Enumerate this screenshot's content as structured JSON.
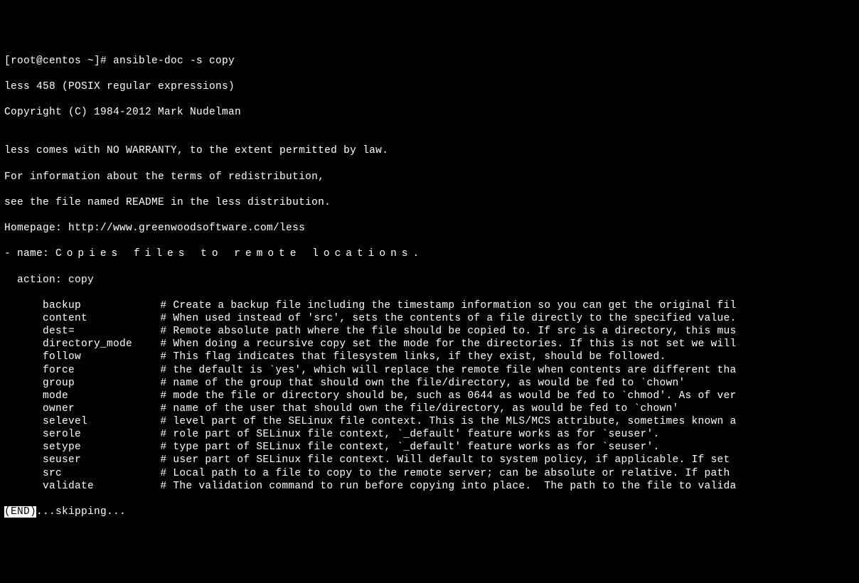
{
  "prompt": "[root@centos ~]# ansible-doc -s copy",
  "less_version": "less 458 (POSIX regular expressions)",
  "copyright": "Copyright (C) 1984-2012 Mark Nudelman",
  "blank": "",
  "warranty": "less comes with NO WARRANTY, to the extent permitted by law.",
  "info1": "For information about the terms of redistribution,",
  "info2": "see the file named README in the less distribution.",
  "homepage": "Homepage: http://www.greenwoodsoftware.com/less",
  "name_prefix": "- name:",
  "name_text": "Copies files to remote locations.",
  "action": "  action: copy",
  "indent": "      ",
  "sep": "# ",
  "options": [
    {
      "name": "backup",
      "desc": "Create a backup file including the timestamp information so you can get the original fil"
    },
    {
      "name": "content",
      "desc": "When used instead of 'src', sets the contents of a file directly to the specified value."
    },
    {
      "name": "dest=",
      "desc": "Remote absolute path where the file should be copied to. If src is a directory, this mus"
    },
    {
      "name": "directory_mode",
      "desc": "When doing a recursive copy set the mode for the directories. If this is not set we will"
    },
    {
      "name": "follow",
      "desc": "This flag indicates that filesystem links, if they exist, should be followed."
    },
    {
      "name": "force",
      "desc": "the default is `yes', which will replace the remote file when contents are different tha"
    },
    {
      "name": "group",
      "desc": "name of the group that should own the file/directory, as would be fed to `chown'"
    },
    {
      "name": "mode",
      "desc": "mode the file or directory should be, such as 0644 as would be fed to `chmod'. As of ver"
    },
    {
      "name": "owner",
      "desc": "name of the user that should own the file/directory, as would be fed to `chown'"
    },
    {
      "name": "selevel",
      "desc": "level part of the SELinux file context. This is the MLS/MCS attribute, sometimes known a"
    },
    {
      "name": "serole",
      "desc": "role part of SELinux file context, `_default' feature works as for `seuser'."
    },
    {
      "name": "setype",
      "desc": "type part of SELinux file context, `_default' feature works as for `seuser'."
    },
    {
      "name": "seuser",
      "desc": "user part of SELinux file context. Will default to system policy, if applicable. If set"
    },
    {
      "name": "src",
      "desc": "Local path to a file to copy to the remote server; can be absolute or relative. If path"
    },
    {
      "name": "validate",
      "desc": "The validation command to run before copying into place.  The path to the file to valida"
    }
  ],
  "end_marker": "(END)",
  "skipping": "...skipping..."
}
